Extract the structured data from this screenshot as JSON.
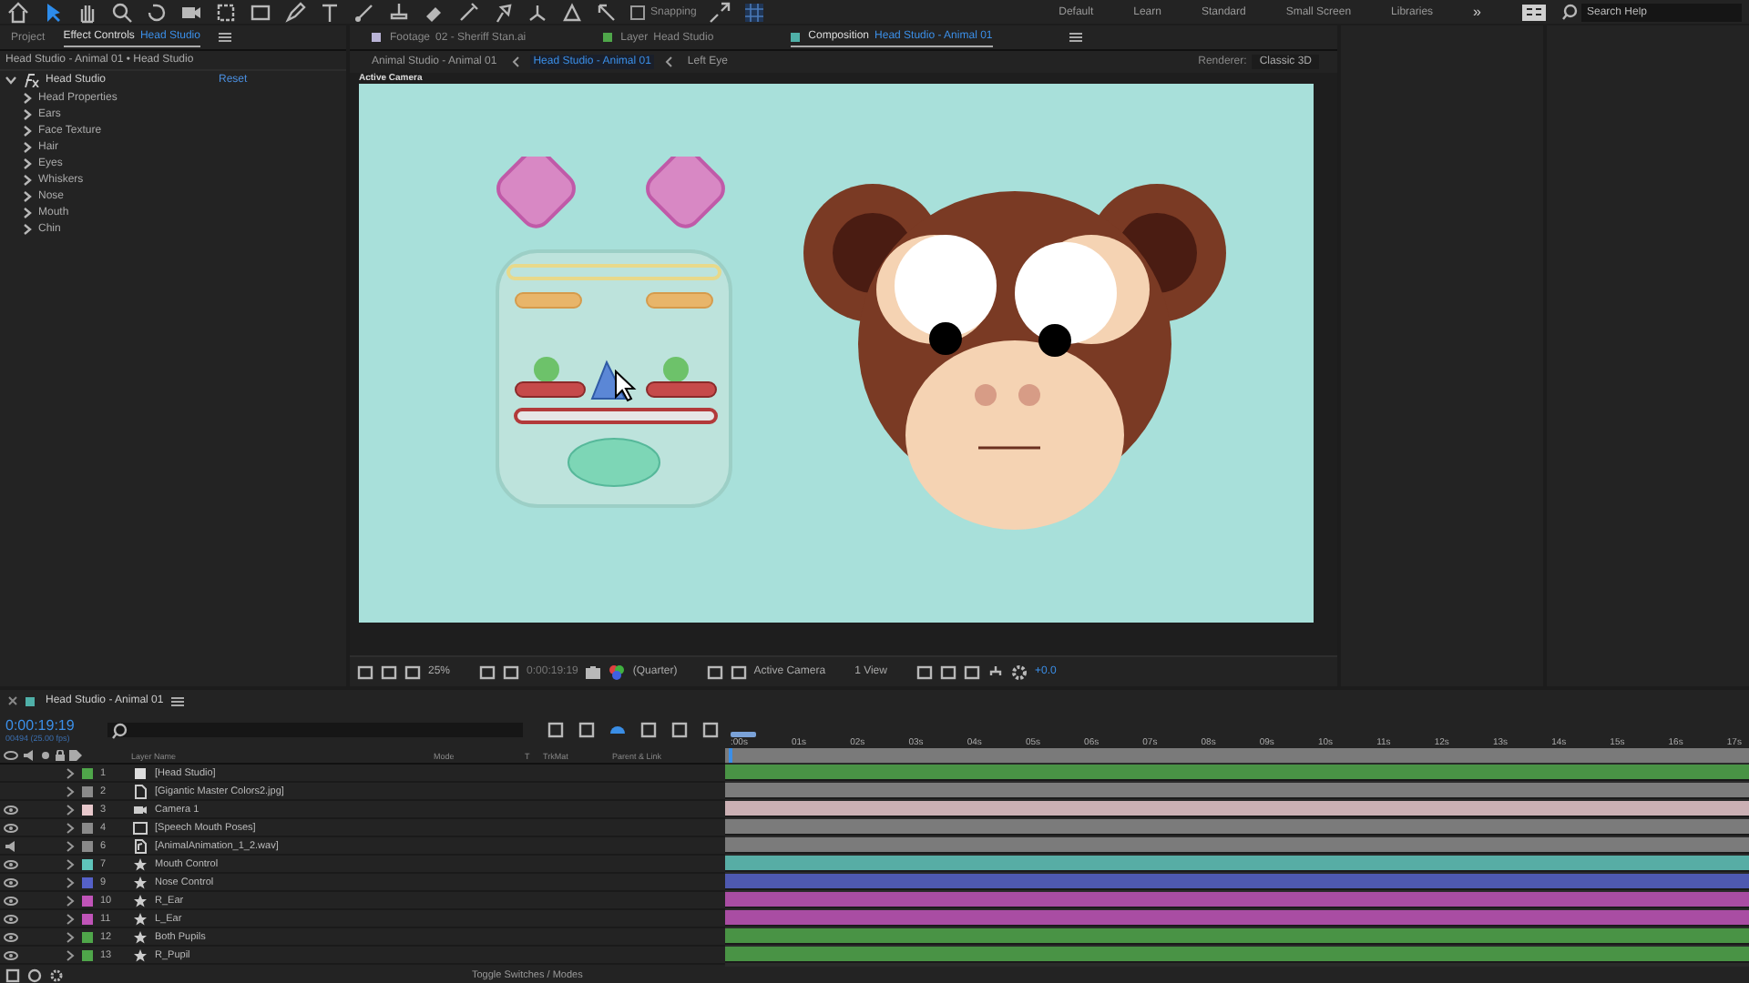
{
  "toolbar": {
    "snapping": {
      "label": "Snapping",
      "checked": false
    },
    "workspaces": [
      {
        "label": "Default",
        "selected": false
      },
      {
        "label": "Learn",
        "selected": false
      },
      {
        "label": "Standard",
        "selected": false
      },
      {
        "label": "Small Screen",
        "selected": false
      },
      {
        "label": "Libraries",
        "selected": false
      }
    ],
    "more": "»",
    "search": {
      "placeholder": "Search Help"
    }
  },
  "effect_controls": {
    "tabs": [
      {
        "label": "Project",
        "selected": false
      },
      {
        "label": "Effect Controls",
        "sublabel": "Head Studio",
        "selected": true
      }
    ],
    "path": "Head Studio - Animal 01 • Head Studio",
    "effect": {
      "name": "Head Studio",
      "reset": "Reset",
      "expanded": true,
      "children": [
        {
          "label": "Head Properties",
          "expanded": false
        },
        {
          "label": "Ears",
          "expanded": false
        },
        {
          "label": "Face Texture",
          "expanded": false
        },
        {
          "label": "Hair",
          "expanded": false
        },
        {
          "label": "Eyes",
          "expanded": false
        },
        {
          "label": "Whiskers",
          "expanded": false
        },
        {
          "label": "Nose",
          "expanded": false
        },
        {
          "label": "Mouth",
          "expanded": false
        },
        {
          "label": "Chin",
          "expanded": false
        }
      ]
    }
  },
  "composition": {
    "tabs": [
      {
        "label": "Footage",
        "sublabel": "02 - Sheriff Stan.ai",
        "color": "#b9b3d6",
        "selected": false
      },
      {
        "label": "Layer",
        "sublabel": "Head Studio",
        "color": "#4fa64a",
        "selected": false
      },
      {
        "label": "Composition",
        "sublabel": "Head Studio - Animal 01",
        "color": "#4fb0a8",
        "selected": true
      }
    ],
    "breadcrumbs": [
      {
        "label": "Animal Studio - Animal 01",
        "selected": false
      },
      {
        "label": "Head Studio - Animal 01",
        "selected": true
      },
      {
        "label": "Left Eye",
        "selected": false
      }
    ],
    "renderer": {
      "label": "Renderer:",
      "value": "Classic 3D"
    },
    "viewer_label": "Active Camera",
    "viewer_toolbar": {
      "zoom": "25%",
      "time": "0:00:19:19",
      "resolution": "(Quarter)",
      "camera": "Active Camera",
      "views": "1 View",
      "exposure": "+0.0"
    }
  },
  "timeline": {
    "title": "Head Studio - Animal 01",
    "timecode": "0:00:19:19",
    "frame_info": "00494 (25.00 fps)",
    "columns": [
      "Layer Name",
      "Mode",
      "T",
      "TrkMat",
      "Parent & Link"
    ],
    "ruler": [
      ":00s",
      "01s",
      "02s",
      "03s",
      "04s",
      "05s",
      "06s",
      "07s",
      "08s",
      "09s",
      "10s",
      "11s",
      "12s",
      "13s",
      "14s",
      "15s",
      "16s",
      "17s"
    ],
    "layers": [
      {
        "number": "1",
        "name": "[Head Studio]",
        "kind": "solid",
        "color": "#4fa64a",
        "visible": false
      },
      {
        "number": "2",
        "name": "[Gigantic Master Colors2.jpg]",
        "kind": "footage",
        "color": "#8a8a8a",
        "visible": false
      },
      {
        "number": "3",
        "name": "Camera 1",
        "kind": "camera",
        "color": "#e8c8cc",
        "visible": true
      },
      {
        "number": "4",
        "name": "[Speech Mouth Poses]",
        "kind": "comp",
        "color": "#8a8a8a",
        "visible": true
      },
      {
        "number": "6",
        "name": "[AnimalAnimation_1_2.wav]",
        "kind": "audio",
        "color": "#8a8a8a"
      },
      {
        "number": "7",
        "name": "Mouth Control",
        "kind": "null",
        "color": "#5fc4bb",
        "visible": true
      },
      {
        "number": "9",
        "name": "Nose Control",
        "kind": "null",
        "color": "#5561c8",
        "visible": true
      },
      {
        "number": "10",
        "name": "R_Ear",
        "kind": "null",
        "color": "#c054b8",
        "visible": true
      },
      {
        "number": "11",
        "name": "L_Ear",
        "kind": "null",
        "color": "#c054b8",
        "visible": true
      },
      {
        "number": "12",
        "name": "Both Pupils",
        "kind": "null",
        "color": "#4fa64a",
        "visible": true
      },
      {
        "number": "13",
        "name": "R_Pupil",
        "kind": "null",
        "color": "#4fa64a",
        "visible": true
      }
    ],
    "footer": "Toggle Switches / Modes"
  }
}
